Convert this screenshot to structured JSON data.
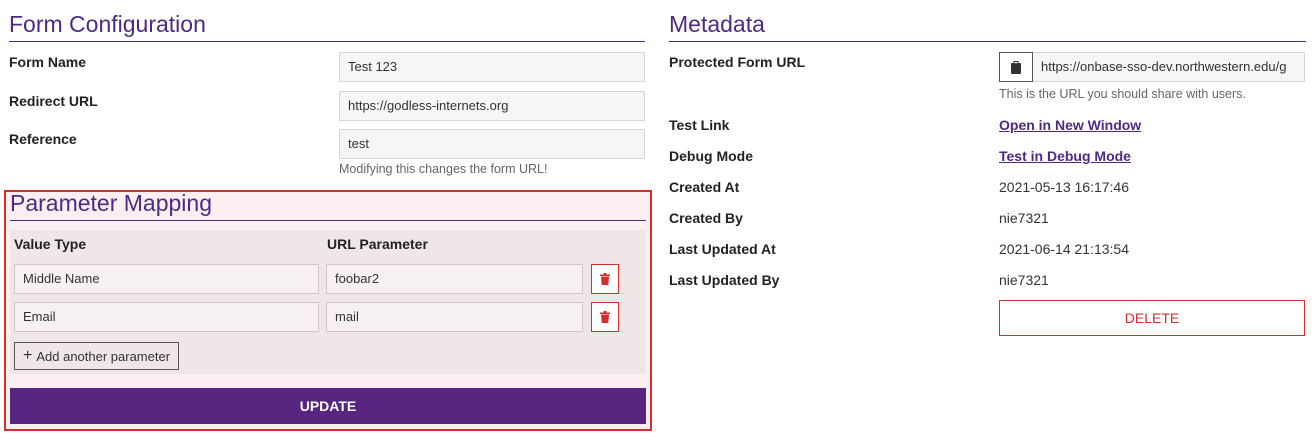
{
  "form_config": {
    "title": "Form Configuration",
    "fields": {
      "form_name": {
        "label": "Form Name",
        "value": "Test 123"
      },
      "redirect_url": {
        "label": "Redirect URL",
        "value": "https://godless-internets.org"
      },
      "reference": {
        "label": "Reference",
        "value": "test",
        "help": "Modifying this changes the form URL!"
      }
    }
  },
  "param_mapping": {
    "title": "Parameter Mapping",
    "headers": {
      "value_type": "Value Type",
      "url_parameter": "URL Parameter"
    },
    "rows": [
      {
        "value_type": "Middle Name",
        "url_parameter": "foobar2"
      },
      {
        "value_type": "Email",
        "url_parameter": "mail"
      }
    ],
    "add_label": "Add another parameter",
    "update_label": "UPDATE"
  },
  "metadata": {
    "title": "Metadata",
    "protected_url": {
      "label": "Protected Form URL",
      "value": "https://onbase-sso-dev.northwestern.edu/g",
      "help": "This is the URL you should share with users."
    },
    "test_link": {
      "label": "Test Link",
      "link": "Open in New Window"
    },
    "debug_mode": {
      "label": "Debug Mode",
      "link": "Test in Debug Mode"
    },
    "created_at": {
      "label": "Created At",
      "value": "2021-05-13 16:17:46"
    },
    "created_by": {
      "label": "Created By",
      "value": "nie7321"
    },
    "last_updated_at": {
      "label": "Last Updated At",
      "value": "2021-06-14 21:13:54"
    },
    "last_updated_by": {
      "label": "Last Updated By",
      "value": "nie7321"
    },
    "delete_label": "DELETE"
  },
  "colors": {
    "accent": "#4e2a84",
    "button_bg": "#582680",
    "danger": "#d32f2f",
    "highlight_bg": "#fbeff1"
  },
  "icons": {
    "trash": "trash-icon",
    "clipboard": "clipboard-icon",
    "plus": "plus-icon"
  }
}
